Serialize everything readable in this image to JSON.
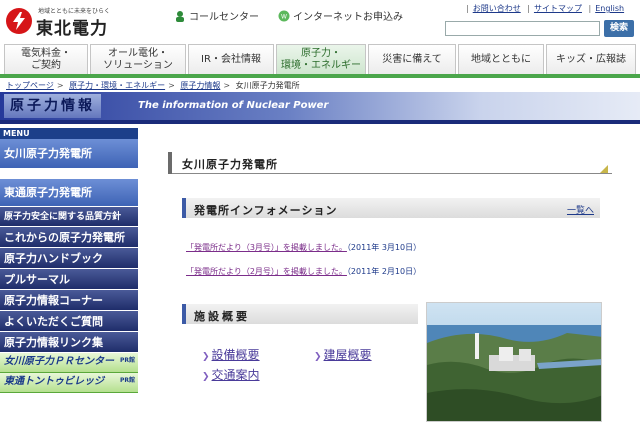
{
  "header": {
    "logo_tagline": "地域とともに未来をひらく",
    "logo_name": "東北電力",
    "call_center": "コールセンター",
    "internet_apply": "インターネットお申込み",
    "util_links": [
      "お問い合わせ",
      "サイトマップ",
      "English"
    ],
    "search_button": "検索",
    "search_value": ""
  },
  "nav": {
    "tabs": [
      {
        "label": "電気料金・\nご契約",
        "active": false
      },
      {
        "label": "オール電化・\nソリューション",
        "active": false
      },
      {
        "label": "IR・会社情報",
        "active": false
      },
      {
        "label": "原子力・\n環境・エネルギー",
        "active": true
      },
      {
        "label": "災害に備えて",
        "active": false
      },
      {
        "label": "地域とともに",
        "active": false
      },
      {
        "label": "キッズ・広報誌",
        "active": false
      }
    ]
  },
  "breadcrumb": [
    "トップページ",
    "原子力・環境・エネルギー",
    "原子力情報",
    "女川原子力発電所"
  ],
  "banner": {
    "title_jp": "原子力情報",
    "title_en": "The information of Nuclear Power"
  },
  "sidebar": {
    "menu_label": "MENU",
    "items": [
      {
        "label": "女川原子力発電所",
        "style": "blue"
      },
      {
        "label": "東通原子力発電所",
        "style": "blue"
      },
      {
        "label": "原子力安全に関する品質方針",
        "style": "navy-small"
      },
      {
        "label": "これからの原子力発電所",
        "style": "navy"
      },
      {
        "label": "原子力ハンドブック",
        "style": "navy"
      },
      {
        "label": "プルサーマル",
        "style": "navy"
      },
      {
        "label": "原子力情報コーナー",
        "style": "navy"
      },
      {
        "label": "よくいただくご質問",
        "style": "navy"
      },
      {
        "label": "原子力情報リンク集",
        "style": "navy"
      },
      {
        "label": "女川原子力ＰＲセンター",
        "style": "green",
        "badge": "PR館"
      },
      {
        "label": "東通トントゥビレッジ",
        "style": "green",
        "badge": "PR館"
      }
    ]
  },
  "main": {
    "plant_title": "女川原子力発電所",
    "info_title": "発電所インフォメーション",
    "info_more": "一覧へ",
    "news": [
      {
        "link": "「発電所だより（3月号）」を掲載しました。",
        "date": "（2011年 3月10日）"
      },
      {
        "link": "「発電所だより（2月号）」を掲載しました。",
        "date": "（2011年 2月10日）"
      }
    ],
    "facility_title": "施設概要",
    "facility_links": [
      "設備概要",
      "建屋概要",
      "交通案内"
    ]
  },
  "colors": {
    "nav_green": "#4ba64b",
    "banner_navy": "#26399a",
    "sidebar_blue": "#3e63b5",
    "sidebar_navy": "#1f2d6a",
    "logo_red": "#d61518"
  }
}
